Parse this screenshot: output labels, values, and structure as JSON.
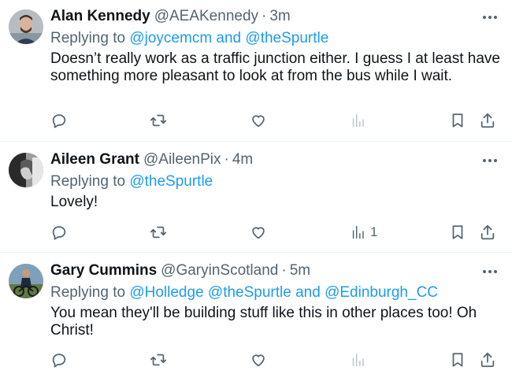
{
  "tweets": [
    {
      "name": "Alan Kennedy",
      "handle": "@AEAKennedy",
      "dot": "·",
      "time": "3m",
      "replying_prefix": "Replying to",
      "mentions": [
        "@joycemcm",
        "@theSpurtle"
      ],
      "joiner": "and",
      "text": "Doesn’t really work as a traffic junction either. I guess I at least have something more pleasant to look at from the bus while I wait.",
      "views": ""
    },
    {
      "name": "Aileen Grant",
      "handle": "@AileenPix",
      "dot": "·",
      "time": "4m",
      "replying_prefix": "Replying to",
      "mentions": [
        "@theSpurtle"
      ],
      "text": "Lovely!",
      "views": "1"
    },
    {
      "name": "Gary Cummins",
      "handle": "@GaryinScotland",
      "dot": "·",
      "time": "5m",
      "replying_prefix": "Replying to",
      "mentions": [
        "@Holledge",
        "@theSpurtle",
        "@Edinburgh_CC"
      ],
      "joiner": "and",
      "text": "You mean they'll be building stuff like this in other places too! Oh Christ!",
      "views": ""
    }
  ],
  "colors": {
    "accent": "#1d9bf0",
    "secondary_text": "#536471",
    "icon": "#536471",
    "views_disabled": "#b9c3cb"
  }
}
